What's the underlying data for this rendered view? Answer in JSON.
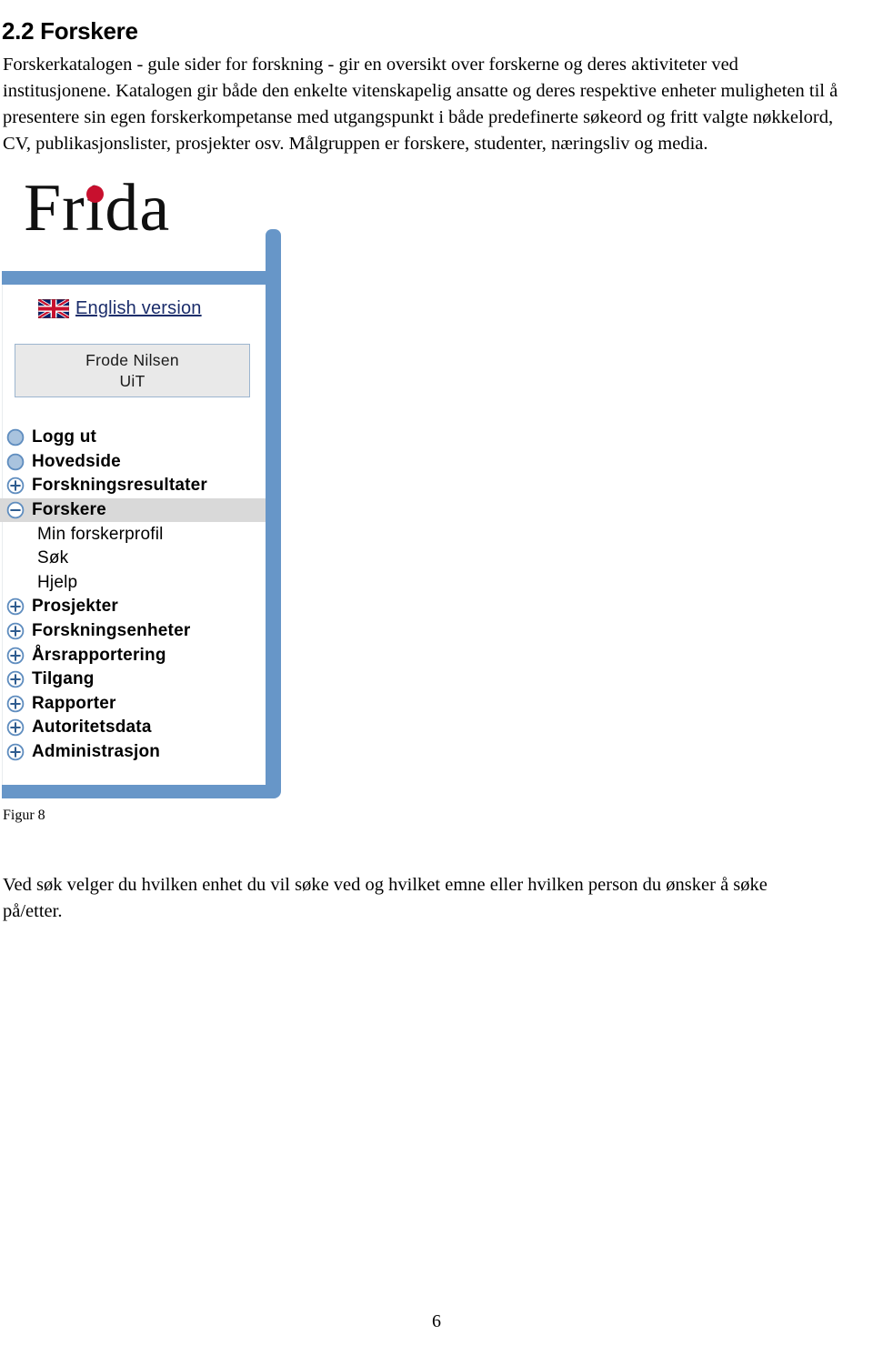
{
  "document": {
    "heading": "2.2 Forskere",
    "intro_paragraph": "Forskerkatalogen - gule sider for forskning - gir en oversikt over forskerne og deres aktiviteter ved institusjonene. Katalogen gir både den enkelte vitenskapelig ansatte og deres respektive enheter muligheten til å presentere sin egen forskerkompetanse med utgangspunkt i både predefinerte søkeord og fritt valgte nøkkelord, CV, publikasjonslister, prosjekter osv. Målgruppen er forskere, studenter, næringsliv og media.",
    "figure_caption": "Figur 8",
    "closing_paragraph": "Ved søk velger du hvilken enhet du vil søke ved og hvilket emne eller hvilken person du ønsker å søke på/etter.",
    "page_number": "6"
  },
  "screenshot": {
    "brand": {
      "text_before": "Fr",
      "text_i": "i",
      "text_after": "da",
      "dot_color": "#c8102e"
    },
    "language_link": {
      "label": "English version",
      "icon": "uk-flag-icon",
      "color": "#1b2d6b"
    },
    "user_box": {
      "name": "Frode Nilsen",
      "institution": "UiT"
    },
    "frame_color": "#6796c8",
    "selected_highlight_color": "#d9d9d9",
    "nav": [
      {
        "label": "Logg ut",
        "icon": "bullet-circle-icon",
        "level": "top",
        "state": "leaf",
        "selected": false
      },
      {
        "label": "Hovedside",
        "icon": "bullet-circle-icon",
        "level": "top",
        "state": "leaf",
        "selected": false
      },
      {
        "label": "Forskningsresultater",
        "icon": "plus-circle-icon",
        "level": "top",
        "state": "collapsed",
        "selected": false
      },
      {
        "label": "Forskere",
        "icon": "minus-circle-icon",
        "level": "top",
        "state": "expanded",
        "selected": true
      },
      {
        "label": "Min forskerprofil",
        "icon": "none",
        "level": "child",
        "state": "leaf",
        "selected": false
      },
      {
        "label": "Søk",
        "icon": "none",
        "level": "child",
        "state": "leaf",
        "selected": false
      },
      {
        "label": "Hjelp",
        "icon": "none",
        "level": "child",
        "state": "leaf",
        "selected": false
      },
      {
        "label": "Prosjekter",
        "icon": "plus-circle-icon",
        "level": "top",
        "state": "collapsed",
        "selected": false
      },
      {
        "label": "Forskningsenheter",
        "icon": "plus-circle-icon",
        "level": "top",
        "state": "collapsed",
        "selected": false
      },
      {
        "label": "Årsrapportering",
        "icon": "plus-circle-icon",
        "level": "top",
        "state": "collapsed",
        "selected": false
      },
      {
        "label": "Tilgang",
        "icon": "plus-circle-icon",
        "level": "top",
        "state": "collapsed",
        "selected": false
      },
      {
        "label": "Rapporter",
        "icon": "plus-circle-icon",
        "level": "top",
        "state": "collapsed",
        "selected": false
      },
      {
        "label": "Autoritetsdata",
        "icon": "plus-circle-icon",
        "level": "top",
        "state": "collapsed",
        "selected": false
      },
      {
        "label": "Administrasjon",
        "icon": "plus-circle-icon",
        "level": "top",
        "state": "collapsed",
        "selected": false
      }
    ]
  }
}
